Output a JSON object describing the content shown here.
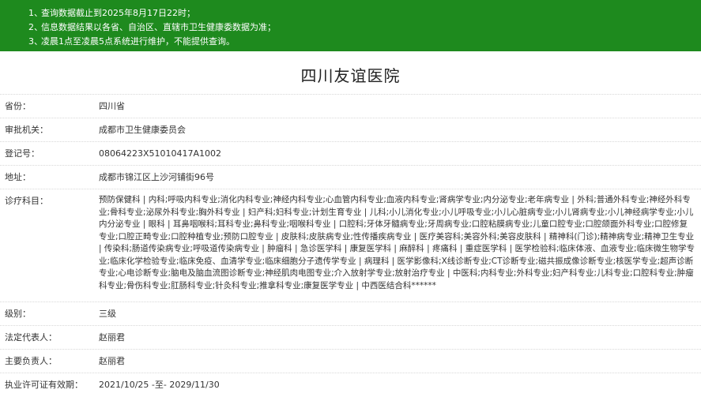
{
  "notice": {
    "items": [
      {
        "num": "1、",
        "text": "查询数据截止到2025年8月17日22时；"
      },
      {
        "num": "2、",
        "text": "信息数据结果以各省、自治区、直辖市卫生健康委数据为准；"
      },
      {
        "num": "3、",
        "text": "凌晨1点至凌晨5点系统进行维护，不能提供查询。"
      }
    ]
  },
  "hospital_name": "四川友谊医院",
  "fields": {
    "province": {
      "label": "省份：",
      "value": "四川省"
    },
    "approval": {
      "label": "审批机关：",
      "value": "成都市卫生健康委员会"
    },
    "registration": {
      "label": "登记号：",
      "value": "08064223X51010417A1002"
    },
    "address": {
      "label": "地址：",
      "value": "成都市锦江区上沙河铺街96号"
    },
    "departments": {
      "label": "诊疗科目：",
      "value": "预防保健科 | 内科;呼吸内科专业;消化内科专业;神经内科专业;心血管内科专业;血液内科专业;肾病学专业;内分泌专业;老年病专业 | 外科;普通外科专业;神经外科专业;骨科专业;泌尿外科专业;胸外科专业 | 妇产科;妇科专业;计划生育专业 | 儿科;小儿消化专业;小儿呼吸专业;小儿心脏病专业;小儿肾病专业;小儿神经病学专业;小儿内分泌专业 | 眼科 | 耳鼻咽喉科;耳科专业;鼻科专业;咽喉科专业 | 口腔科;牙体牙髓病专业;牙周病专业;口腔粘膜病专业;儿童口腔专业;口腔颌面外科专业;口腔修复专业;口腔正畸专业;口腔种植专业;预防口腔专业 | 皮肤科;皮肤病专业;性传播疾病专业 | 医疗美容科;美容外科;美容皮肤科 | 精神科(门诊);精神病专业;精神卫生专业 | 传染科;肠道传染病专业;呼吸道传染病专业 | 肿瘤科 | 急诊医学科 | 康复医学科 | 麻醉科 | 疼痛科 | 重症医学科 | 医学检验科;临床体液、血液专业;临床微生物学专业;临床化学检验专业;临床免疫、血清学专业;临床细胞分子遗传学专业 | 病理科 | 医学影像科;X线诊断专业;CT诊断专业;磁共振成像诊断专业;核医学专业;超声诊断专业;心电诊断专业;脑电及脑血流图诊断专业;神经肌肉电图专业;介入放射学专业;放射治疗专业 | 中医科;内科专业;外科专业;妇产科专业;儿科专业;口腔科专业;肿瘤科专业;骨伤科专业;肛肠科专业;针灸科专业;推拿科专业;康复医学专业 | 中西医结合科******"
    },
    "level": {
      "label": "级别：",
      "value": "三级"
    },
    "legal_rep": {
      "label": "法定代表人：",
      "value": "赵丽君"
    },
    "principal": {
      "label": "主要负责人：",
      "value": "赵丽君"
    },
    "license_validity": {
      "label": "执业许可证有效期：",
      "value": "2021/10/25 -至- 2029/11/30"
    }
  },
  "colors": {
    "notice_bg": "#1e8a1e",
    "notice_text": "#ffffff"
  }
}
